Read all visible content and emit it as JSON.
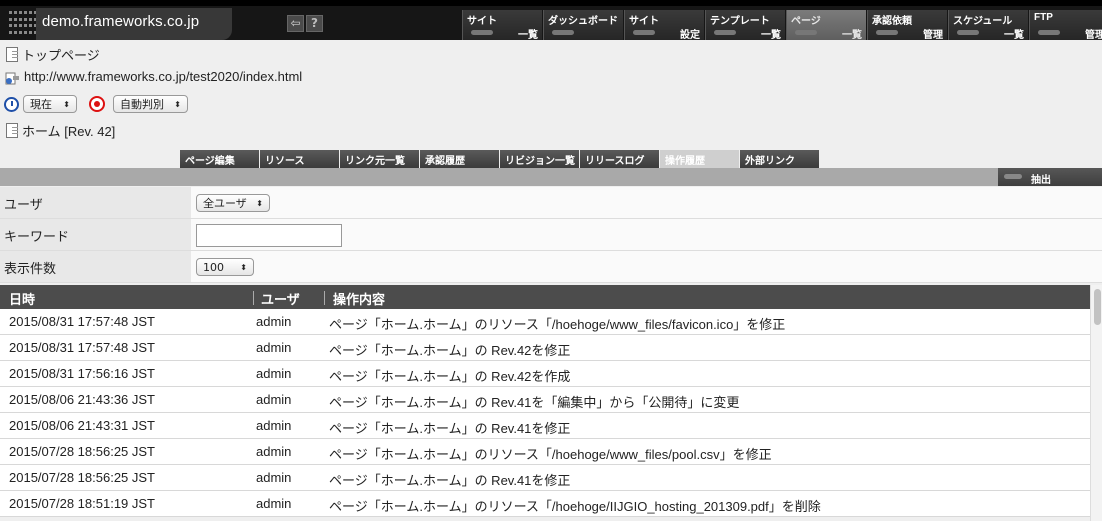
{
  "header": {
    "site_title": "demo.frameworks.co.jp",
    "back_btn": "⇦",
    "help_btn": "?",
    "nav": [
      {
        "l1": "サイト",
        "l2": "一覧",
        "active": false
      },
      {
        "l1": "ダッシュボード",
        "l2": "",
        "active": false
      },
      {
        "l1": "サイト",
        "l2": "設定",
        "active": false
      },
      {
        "l1": "テンプレート",
        "l2": "一覧",
        "active": false
      },
      {
        "l1": "ページ",
        "l2": "一覧",
        "active": true
      },
      {
        "l1": "承認依頼",
        "l2": "管理",
        "active": false
      },
      {
        "l1": "スケジュール",
        "l2": "一覧",
        "active": false
      },
      {
        "l1": "FTP",
        "l2": "管理",
        "active": false
      }
    ]
  },
  "info": {
    "page_name": "トップページ",
    "url": "http://www.frameworks.co.jp/test2020/index.html",
    "time_select": "現在",
    "detect_select": "自動判別",
    "revision": "ホーム [Rev. 42]"
  },
  "tabs": [
    "ページ編集",
    "リソース",
    "リンク元一覧",
    "承認履歴",
    "リビジョン一覧",
    "リリースログ",
    "操作履歴",
    "外部リンク"
  ],
  "active_tab": "操作履歴",
  "extract_label": "抽出",
  "filters": {
    "user_label": "ユーザ",
    "user_value": "全ユーザ",
    "keyword_label": "キーワード",
    "keyword_value": "",
    "count_label": "表示件数",
    "count_value": "100"
  },
  "table": {
    "headers": [
      "日時",
      "ユーザ",
      "操作内容"
    ],
    "rows": [
      [
        "2015/08/31 17:57:48 JST",
        "admin",
        "ページ「ホーム.ホーム」のリソース「/hoehoge/www_files/favicon.ico」を修正"
      ],
      [
        "2015/08/31 17:57:48 JST",
        "admin",
        "ページ「ホーム.ホーム」の Rev.42を修正"
      ],
      [
        "2015/08/31 17:56:16 JST",
        "admin",
        "ページ「ホーム.ホーム」の Rev.42を作成"
      ],
      [
        "2015/08/06 21:43:36 JST",
        "admin",
        "ページ「ホーム.ホーム」の Rev.41を「編集中」から「公開待」に変更"
      ],
      [
        "2015/08/06 21:43:31 JST",
        "admin",
        "ページ「ホーム.ホーム」の Rev.41を修正"
      ],
      [
        "2015/07/28 18:56:25 JST",
        "admin",
        "ページ「ホーム.ホーム」のリソース「/hoehoge/www_files/pool.csv」を修正"
      ],
      [
        "2015/07/28 18:56:25 JST",
        "admin",
        "ページ「ホーム.ホーム」の Rev.41を修正"
      ],
      [
        "2015/07/28 18:51:19 JST",
        "admin",
        "ページ「ホーム.ホーム」のリソース「/hoehoge/IIJGIO_hosting_201309.pdf」を削除"
      ]
    ]
  }
}
